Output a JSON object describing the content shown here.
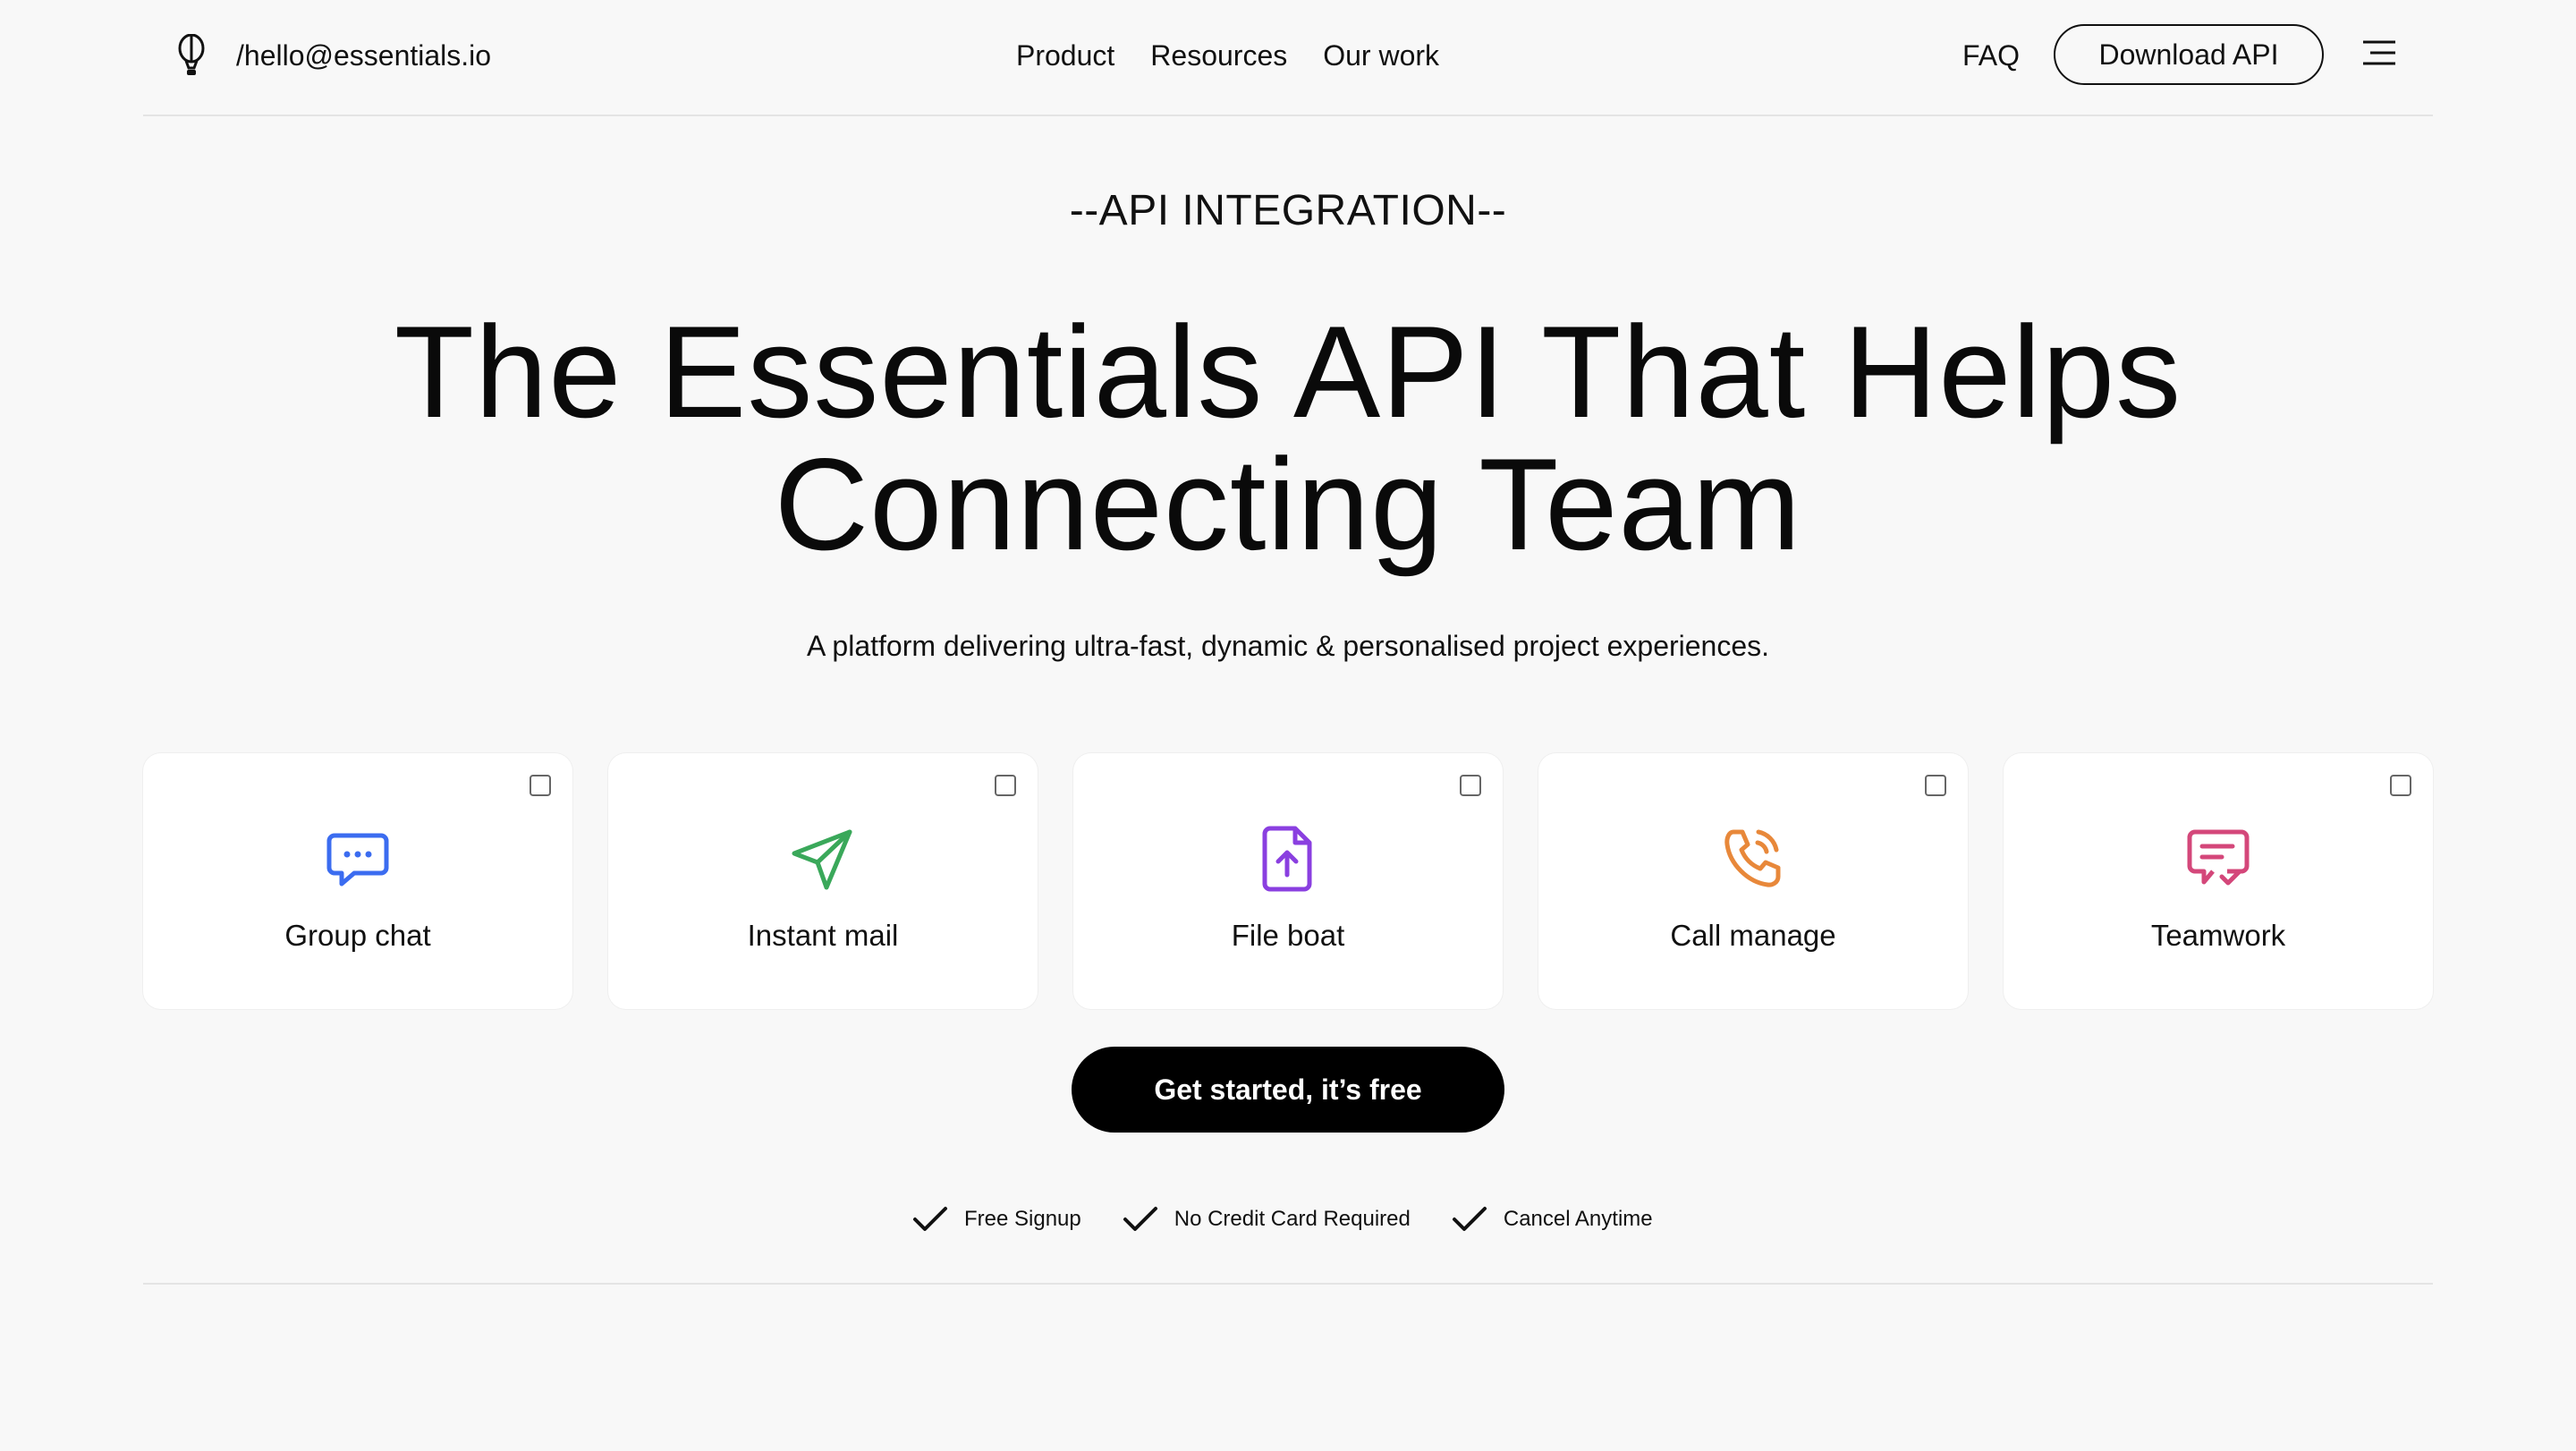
{
  "header": {
    "email": "/hello@essentials.io",
    "nav": [
      "Product",
      "Resources",
      "Our work"
    ],
    "faq": "FAQ",
    "download_label": "Download API"
  },
  "hero": {
    "eyebrow": "--API INTEGRATION--",
    "headline_line1": "The Essentials API That Helps",
    "headline_line2": "Connecting Team",
    "subtext": "A platform delivering ultra-fast, dynamic & personalised project experiences."
  },
  "cards": [
    {
      "label": "Group chat",
      "icon": "chat-bubble-icon",
      "color": "#3b6cf0",
      "checked": false
    },
    {
      "label": "Instant mail",
      "icon": "paper-plane-icon",
      "color": "#3aa85a",
      "checked": false
    },
    {
      "label": "File boat",
      "icon": "file-upload-icon",
      "color": "#8a3fe0",
      "checked": false
    },
    {
      "label": "Call manage",
      "icon": "phone-call-icon",
      "color": "#e8883a",
      "checked": false
    },
    {
      "label": "Teamwork",
      "icon": "message-check-icon",
      "color": "#d4477a",
      "checked": false
    }
  ],
  "cta": {
    "label": "Get started, it’s free"
  },
  "features": [
    "Free Signup",
    "No Credit Card Required",
    "Cancel Anytime"
  ],
  "colors": {
    "background": "#f8f8f8",
    "card": "#ffffff",
    "text": "#111111",
    "cta_bg": "#000000"
  }
}
